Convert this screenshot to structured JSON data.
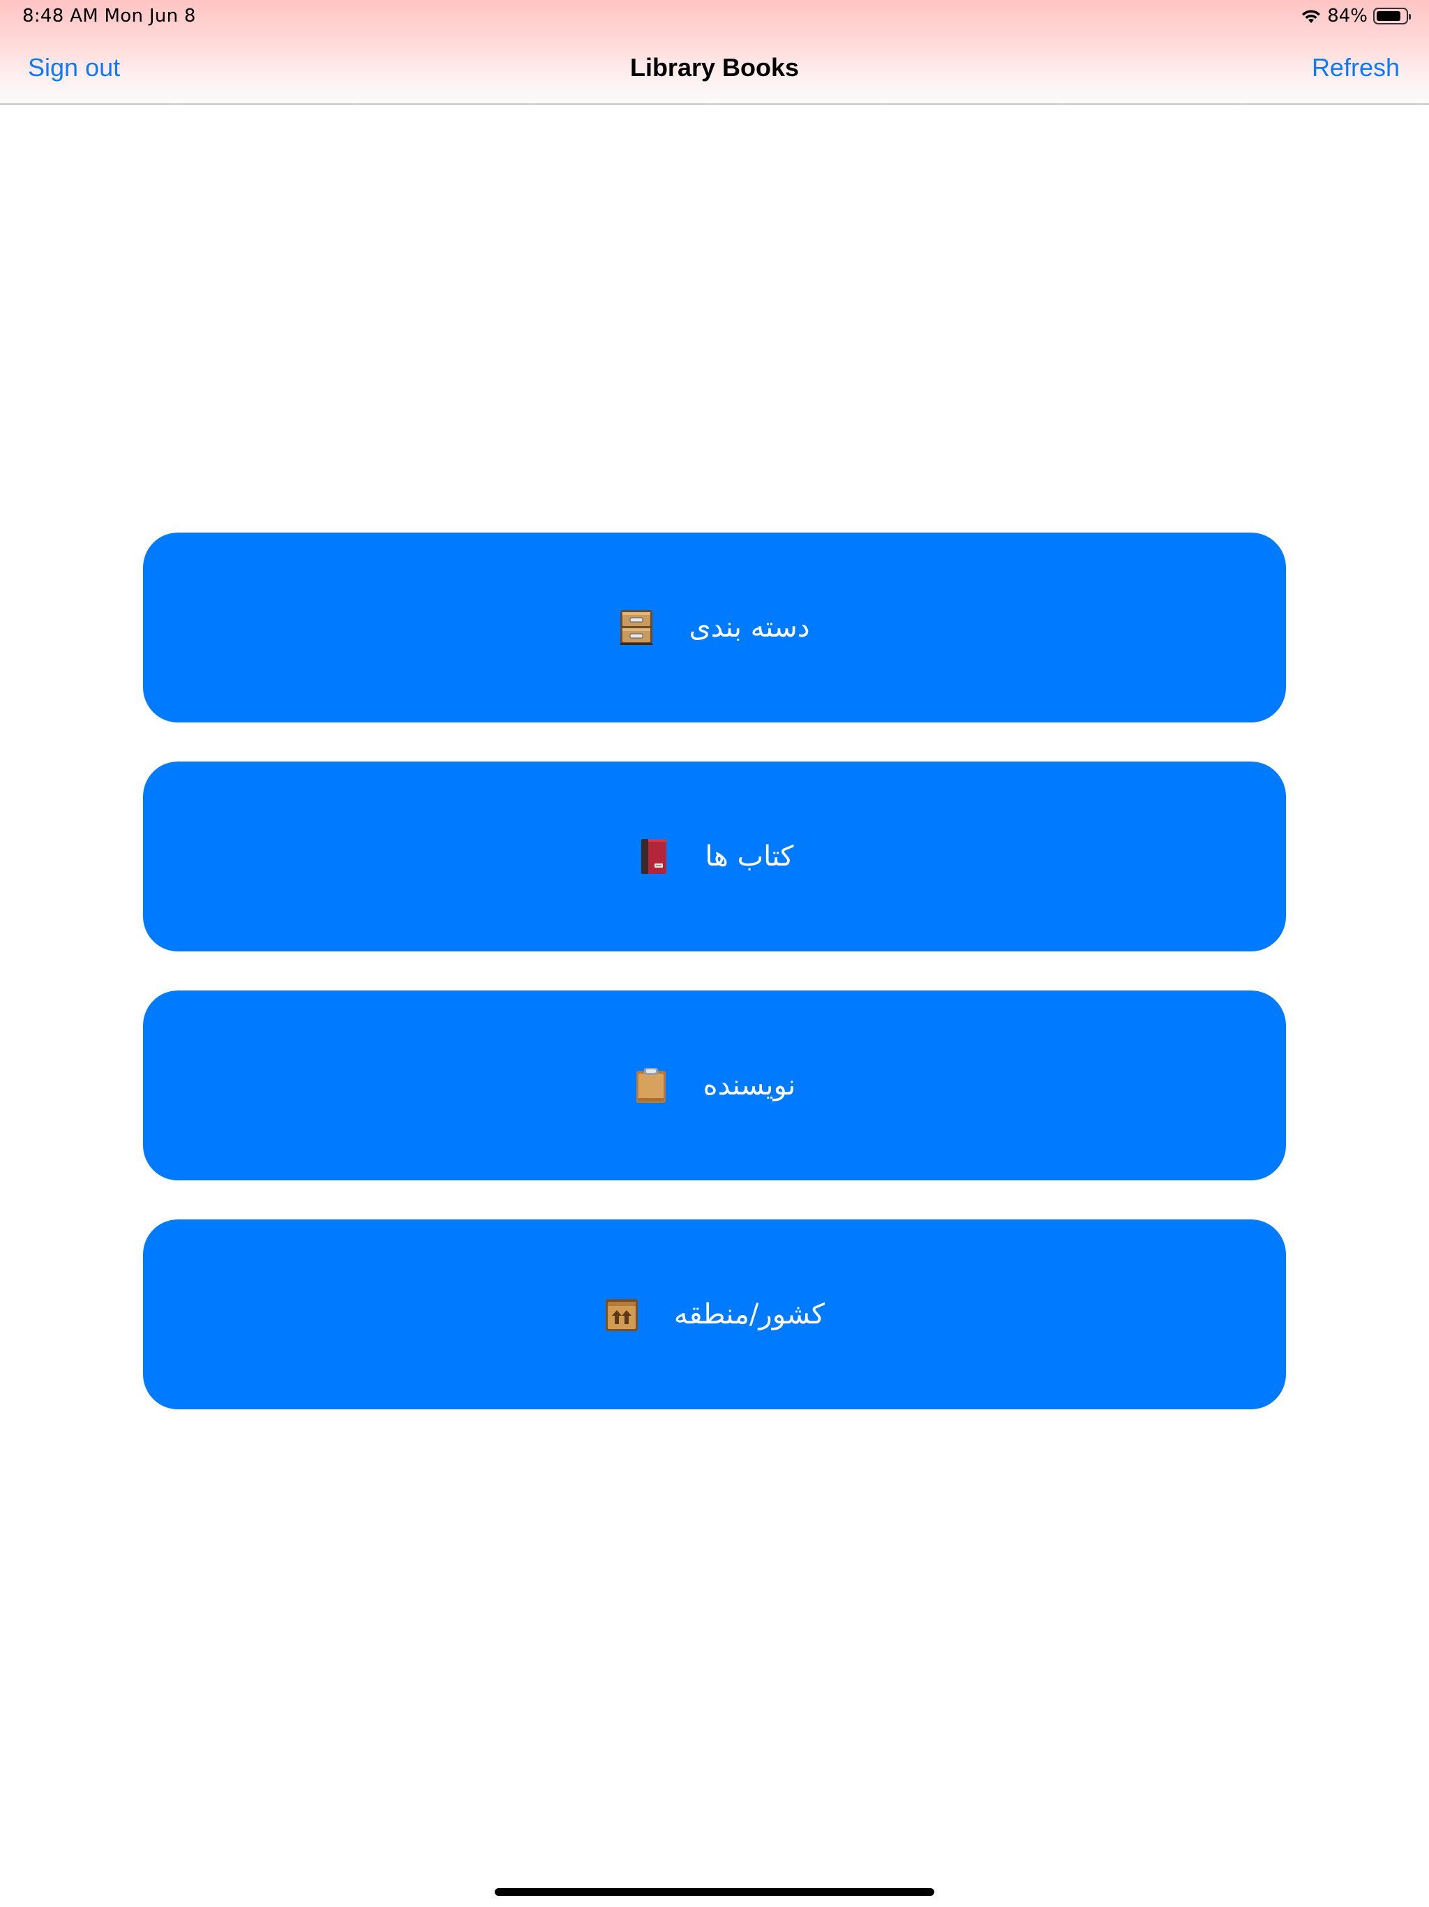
{
  "status_bar": {
    "time_date": "8:48 AM   Mon Jun 8",
    "battery_percent_label": "84%",
    "battery_level": 0.84
  },
  "nav_bar": {
    "left_label": "Sign out",
    "title": "Library Books",
    "right_label": "Refresh"
  },
  "menu": {
    "items": [
      {
        "label": "دسته بندی",
        "icon": "file-cabinet-icon"
      },
      {
        "label": "کتاب ها",
        "icon": "closed-book-icon"
      },
      {
        "label": "نویسنده",
        "icon": "clipboard-icon"
      },
      {
        "label": "کشور/منطقه",
        "icon": "package-box-icon"
      }
    ]
  },
  "colors": {
    "accent": "#007aff",
    "link": "#0a7aff",
    "header_tint": "#ffc4c4"
  }
}
